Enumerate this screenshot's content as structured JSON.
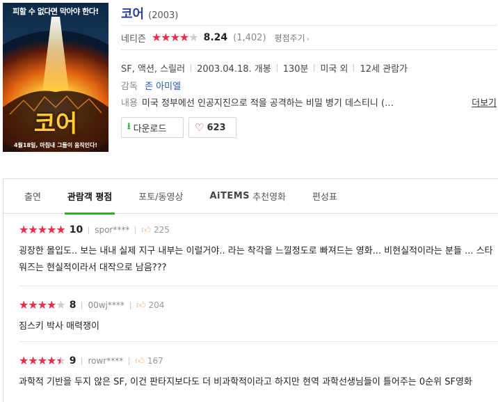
{
  "movie": {
    "title": "코어",
    "year": "(2003)",
    "poster": {
      "tagline_top": "피할 수 없다면 막아야 한다!",
      "title_text": "코어",
      "tagline_bottom": "4월18일, 마침내 그들이 움직인다!"
    }
  },
  "rating": {
    "label": "네티즌",
    "score": "8.24",
    "stars_fraction": 0.824,
    "count": "(1,402)",
    "rate_link": "평점주기"
  },
  "meta": {
    "genre": "SF, 액션, 스릴러",
    "release": "2003.04.18. 개봉",
    "runtime": "130분",
    "country": "미국 외",
    "age": "12세 관람가"
  },
  "director": {
    "label": "감독",
    "name": "존 아미엘"
  },
  "summary": {
    "label": "내용",
    "text": "미국 정부에선 인공지진으로 적을 공격하는 비밀 병기 데스티니 (…",
    "more": "더보기"
  },
  "actions": {
    "download_label": "다운로드",
    "like_count": "623"
  },
  "tabs": [
    {
      "label": "출연",
      "active": false
    },
    {
      "label": "관람객 평점",
      "active": true
    },
    {
      "label": "포토/동영상",
      "active": false
    },
    {
      "label": "AiTEMS",
      "label_suffix": "추천영화",
      "active": false
    },
    {
      "label": "편성표",
      "active": false
    }
  ],
  "reviews": [
    {
      "score": "10",
      "stars_fraction": 1.0,
      "user": "spor****",
      "likes": "225",
      "text": "굉장한 몰입도.. 보는 내내 실제 지구 내부는 이럴거야.. 라는 착각을 느낄정도로 빠져드는 영화... 비현실적이라는 분들 ... 스타워즈는 현실적이라서 대작으로 남음???"
    },
    {
      "score": "8",
      "stars_fraction": 0.8,
      "user": "00wj****",
      "likes": "204",
      "text": "짐스키 박사 매력쟁이"
    },
    {
      "score": "9",
      "stars_fraction": 0.9,
      "user": "rowr****",
      "likes": "167",
      "text": "과학적 기반을 두지 않은 SF, 이건 판타지보다도 더 비과학적이라고 하지만 현역 과학선생님들이 틀어주는 0순위 SF영화"
    }
  ],
  "colors": {
    "star": "#e5304a",
    "tab_accent": "#2db400",
    "title": "#2a3f8f"
  }
}
